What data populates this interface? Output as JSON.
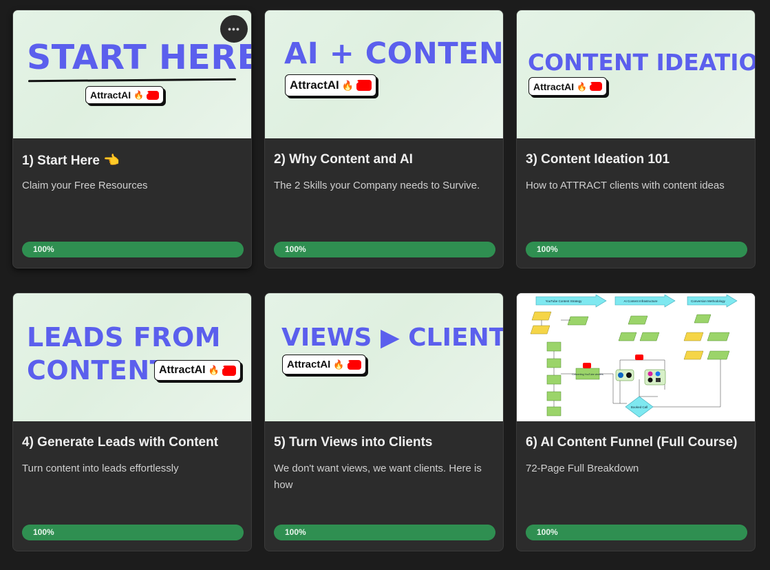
{
  "courses": [
    {
      "thumb_text": [
        "START HERE"
      ],
      "brand": "AttractAI",
      "title": "1) Start Here 👈",
      "subtitle": "Claim your Free Resources",
      "progress": 100,
      "progress_label": "100%"
    },
    {
      "thumb_text": [
        "AI + CONTENT"
      ],
      "brand": "AttractAI",
      "title": "2) Why Content and AI",
      "subtitle": "The 2 Skills your Company needs to Survive.",
      "progress": 100,
      "progress_label": "100%"
    },
    {
      "thumb_text": [
        "CONTENT IDEATION"
      ],
      "brand": "AttractAI",
      "title": "3) Content Ideation 101",
      "subtitle": "How to ATTRACT clients with content ideas",
      "progress": 100,
      "progress_label": "100%"
    },
    {
      "thumb_text": [
        "LEADS FROM",
        "CONTENT"
      ],
      "brand": "AttractAI",
      "title": "4) Generate Leads with Content",
      "subtitle": "Turn content into leads effortlessly",
      "progress": 100,
      "progress_label": "100%"
    },
    {
      "thumb_text": [
        "VIEWS ▶ CLIENTS"
      ],
      "brand": "AttractAI",
      "title": "5) Turn Views into Clients",
      "subtitle": "We don't want views, we want clients. Here is how",
      "progress": 100,
      "progress_label": "100%"
    },
    {
      "diagram_labels": [
        "YouTube Content Strategy",
        "AI Content Infrastructure",
        "Conversion Methodology",
        "Converting YouTube viewers",
        "Booked Call"
      ],
      "title": "6) AI Content Funnel (Full Course)",
      "subtitle": "72-Page Full Breakdown",
      "progress": 100,
      "progress_label": "100%"
    }
  ],
  "more_button": "•••",
  "colors": {
    "thumb_text": "#5b5fed",
    "progress": "#2d8a4e",
    "card": "#2c2c2c",
    "background": "#1c1c1c"
  }
}
